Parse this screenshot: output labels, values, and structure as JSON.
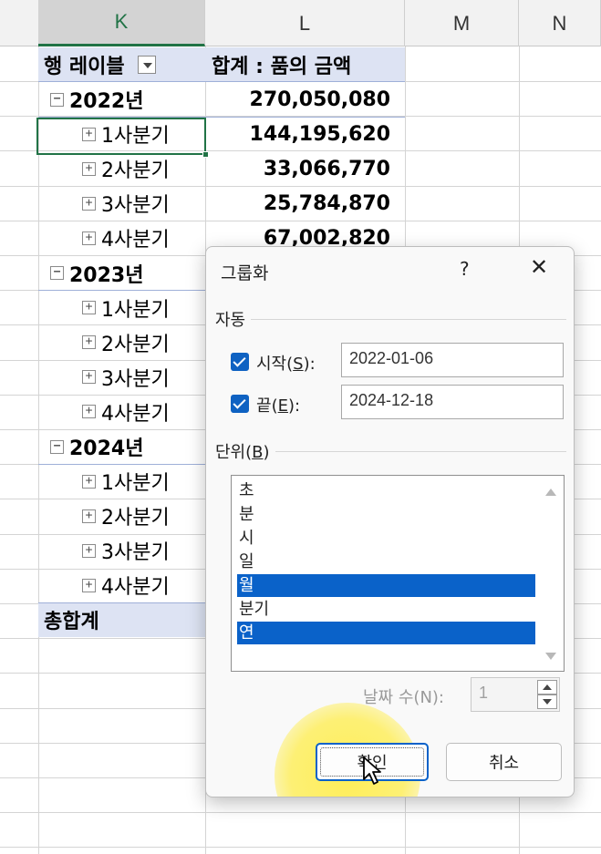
{
  "columns": [
    {
      "id": "K",
      "label": "K",
      "selected": true
    },
    {
      "id": "L",
      "label": "L",
      "selected": false
    },
    {
      "id": "M",
      "label": "M",
      "selected": false
    },
    {
      "id": "N",
      "label": "N",
      "selected": false
    }
  ],
  "pivot": {
    "row_label_header": "행 레이블",
    "value_header": "합계 : 품의 금액",
    "rows": [
      {
        "label": "2022년",
        "value": "270,050,080",
        "level": 0,
        "toggle": "−"
      },
      {
        "label": "1사분기",
        "value": "144,195,620",
        "level": 1,
        "toggle": "+"
      },
      {
        "label": "2사분기",
        "value": "33,066,770",
        "level": 1,
        "toggle": "+"
      },
      {
        "label": "3사분기",
        "value": "25,784,870",
        "level": 1,
        "toggle": "+"
      },
      {
        "label": "4사분기",
        "value": "67,002,820",
        "level": 1,
        "toggle": "+"
      },
      {
        "label": "2023년",
        "value": "",
        "level": 0,
        "toggle": "−"
      },
      {
        "label": "1사분기",
        "value": "",
        "level": 1,
        "toggle": "+"
      },
      {
        "label": "2사분기",
        "value": "",
        "level": 1,
        "toggle": "+"
      },
      {
        "label": "3사분기",
        "value": "",
        "level": 1,
        "toggle": "+"
      },
      {
        "label": "4사분기",
        "value": "",
        "level": 1,
        "toggle": "+"
      },
      {
        "label": "2024년",
        "value": "",
        "level": 0,
        "toggle": "−"
      },
      {
        "label": "1사분기",
        "value": "",
        "level": 1,
        "toggle": "+"
      },
      {
        "label": "2사분기",
        "value": "",
        "level": 1,
        "toggle": "+"
      },
      {
        "label": "3사분기",
        "value": "",
        "level": 1,
        "toggle": "+"
      },
      {
        "label": "4사분기",
        "value": "",
        "level": 1,
        "toggle": "+"
      }
    ],
    "grand_total_label": "총합계"
  },
  "dialog": {
    "title": "그룹화",
    "help": "?",
    "close": "✕",
    "auto_group": "자동",
    "start": {
      "label": "시작",
      "mnemonic": "S",
      "checked": true,
      "value": "2022-01-06"
    },
    "end": {
      "label": "끝",
      "mnemonic": "E",
      "checked": true,
      "value": "2024-12-18"
    },
    "unit_group": "단위",
    "unit_mnemonic": "B",
    "units": [
      {
        "label": "초",
        "selected": false
      },
      {
        "label": "분",
        "selected": false
      },
      {
        "label": "시",
        "selected": false
      },
      {
        "label": "일",
        "selected": false
      },
      {
        "label": "월",
        "selected": true
      },
      {
        "label": "분기",
        "selected": false
      },
      {
        "label": "연",
        "selected": true
      }
    ],
    "days_label": "날짜 수",
    "days_mnemonic": "N",
    "days_value": "1",
    "ok": "확인",
    "cancel": "취소"
  },
  "colors": {
    "accent_green": "#217346",
    "selection_blue": "#0a62c9",
    "pivot_header_bg": "#dde3f3",
    "cursor_highlight": "#ffec3c"
  },
  "icons": [
    "expand-plus-icon",
    "collapse-minus-icon",
    "filter-dropdown-icon",
    "checkbox-checked-icon",
    "close-icon",
    "help-icon",
    "mouse-pointer-icon"
  ]
}
